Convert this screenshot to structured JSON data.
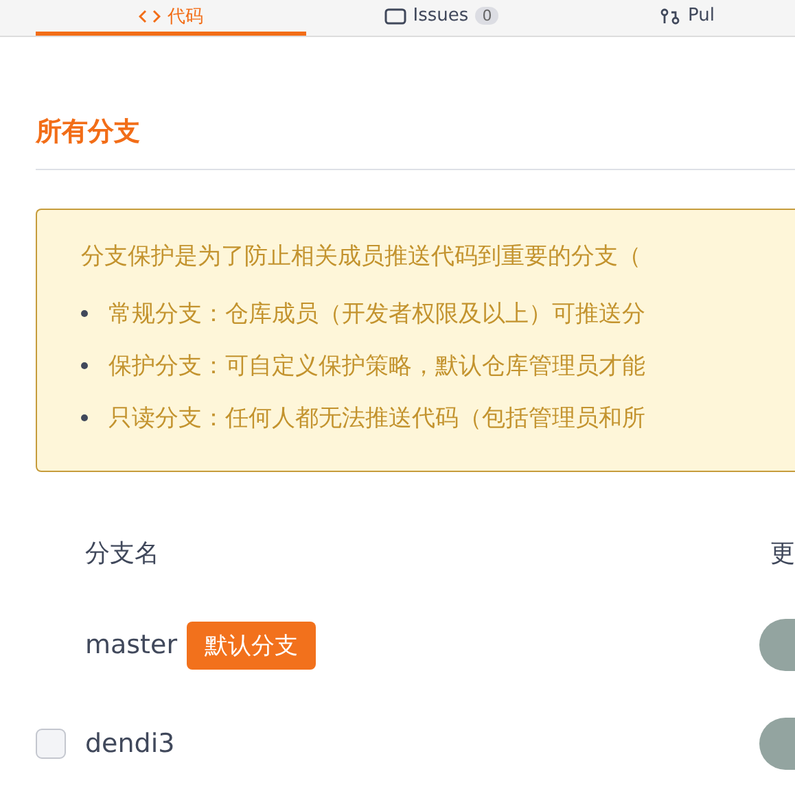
{
  "tabs": [
    {
      "kind": "code",
      "label": "代码",
      "selected": true
    },
    {
      "kind": "issue",
      "label": "Issues",
      "count": "0",
      "selected": false
    },
    {
      "kind": "pull",
      "label": "Pul",
      "selected": false
    }
  ],
  "section_title": "所有分支",
  "notice": {
    "intro": "分支保护是为了防止相关成员推送代码到重要的分支（",
    "items": [
      "常规分支：仓库成员（开发者权限及以上）可推送分",
      "保护分支：可自定义保护策略，默认仓库管理员才能",
      "只读分支：任何人都无法推送代码（包括管理员和所"
    ]
  },
  "table": {
    "columns": [
      "分支名",
      "更"
    ],
    "rows": [
      {
        "name": "master",
        "badge": "默认分支"
      },
      {
        "name": "dendi3",
        "checked": false
      }
    ]
  }
}
